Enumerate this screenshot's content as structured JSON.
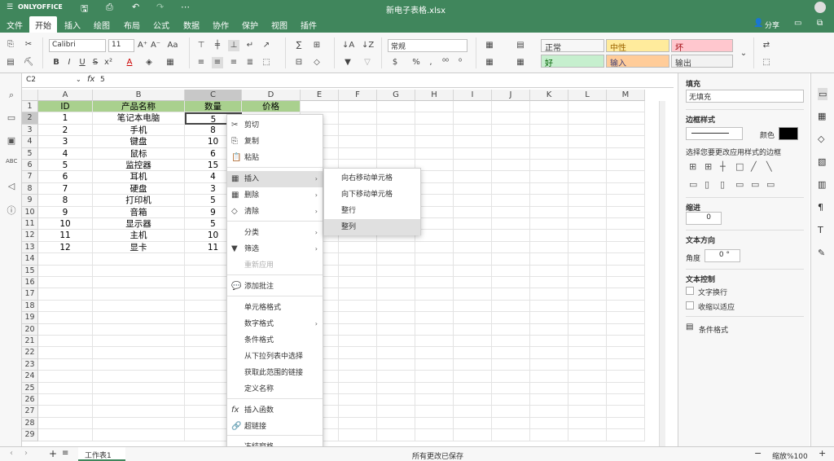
{
  "app": {
    "brand": "ONLYOFFICE",
    "doc_title": "新电子表格.xlsx",
    "share_label": "分享"
  },
  "menu": [
    "文件",
    "开始",
    "插入",
    "绘图",
    "布局",
    "公式",
    "数据",
    "协作",
    "保护",
    "视图",
    "插件"
  ],
  "toolbar": {
    "font_name": "Calibri",
    "font_size": "11",
    "number_format": "常规",
    "styles": [
      {
        "label": "正常",
        "bg": "#ffffff",
        "color": "#000000"
      },
      {
        "label": "中性",
        "bg": "#ffeb9c",
        "color": "#9c6500"
      },
      {
        "label": "坏",
        "bg": "#ffc7ce",
        "color": "#9c0006"
      },
      {
        "label": "好",
        "bg": "#c6efce",
        "color": "#006100"
      },
      {
        "label": "输入",
        "bg": "#ffcc99",
        "color": "#3f3f76"
      },
      {
        "label": "输出",
        "bg": "#f2f2f2",
        "color": "#3f3f3f"
      }
    ]
  },
  "formula_bar": {
    "cell_ref": "C2",
    "fx": "fx",
    "value": "5"
  },
  "sheet": {
    "columns": [
      "A",
      "B",
      "C",
      "D",
      "E",
      "F",
      "G",
      "H",
      "I",
      "J",
      "K",
      "L",
      "M"
    ],
    "headers": [
      "ID",
      "产品名称",
      "数量",
      "价格"
    ],
    "rows": [
      [
        "1",
        "笔记本电脑",
        "5"
      ],
      [
        "2",
        "手机",
        "8"
      ],
      [
        "3",
        "键盘",
        "10"
      ],
      [
        "4",
        "鼠标",
        "6"
      ],
      [
        "5",
        "监控器",
        "15"
      ],
      [
        "6",
        "耳机",
        "4"
      ],
      [
        "7",
        "硬盘",
        "3"
      ],
      [
        "8",
        "打印机",
        "5"
      ],
      [
        "9",
        "音箱",
        "9"
      ],
      [
        "10",
        "显示器",
        "5"
      ],
      [
        "11",
        "主机",
        "10"
      ],
      [
        "12",
        "显卡",
        "11"
      ]
    ],
    "row_count": 29,
    "header_fill": "#a9d08e"
  },
  "context_menu": {
    "items": [
      {
        "label": "剪切",
        "icon": "cut-icon",
        "glyph": "✂"
      },
      {
        "label": "复制",
        "icon": "copy-icon",
        "glyph": "⎘"
      },
      {
        "label": "粘贴",
        "icon": "paste-icon",
        "glyph": "📋"
      },
      {
        "label": "插入",
        "icon": "insert-icon",
        "glyph": "▦",
        "submenu": true
      },
      {
        "label": "删除",
        "icon": "delete-icon",
        "glyph": "▦",
        "submenu": true
      },
      {
        "label": "清除",
        "icon": "clear-icon",
        "glyph": "◇",
        "submenu": true
      },
      {
        "label": "分类",
        "submenu": true
      },
      {
        "label": "筛选",
        "icon": "filter-icon",
        "glyph": "▼",
        "submenu": true
      },
      {
        "label": "重新应用",
        "disabled": true
      },
      {
        "label": "添加批注",
        "icon": "comment-icon",
        "glyph": "💬"
      },
      {
        "label": "单元格格式"
      },
      {
        "label": "数字格式",
        "submenu": true
      },
      {
        "label": "条件格式"
      },
      {
        "label": "从下拉列表中选择"
      },
      {
        "label": "获取此范围的链接"
      },
      {
        "label": "定义名称"
      },
      {
        "label": "插入函数",
        "icon": "function-icon",
        "glyph": "fx"
      },
      {
        "label": "超链接",
        "icon": "link-icon",
        "glyph": "🔗"
      },
      {
        "label": "冻结窗格"
      }
    ],
    "submenu": [
      "向右移动单元格",
      "向下移动单元格",
      "整行",
      "整列"
    ]
  },
  "right_panel": {
    "fill_title": "填充",
    "fill_value": "无填充",
    "border_title": "边框样式",
    "color_label": "颜色",
    "border_hint": "选择您要更改应用样式的边框",
    "indent_title": "缩进",
    "indent_value": "0",
    "text_dir_title": "文本方向",
    "angle_label": "角度",
    "angle_value": "0 °",
    "text_control_title": "文本控制",
    "wrap_label": "文字换行",
    "shrink_label": "收缩以适应",
    "cond_format_label": "条件格式"
  },
  "status": {
    "sheet_tab": "工作表1",
    "save_status": "所有更改已保存",
    "zoom": "缩放%100"
  }
}
